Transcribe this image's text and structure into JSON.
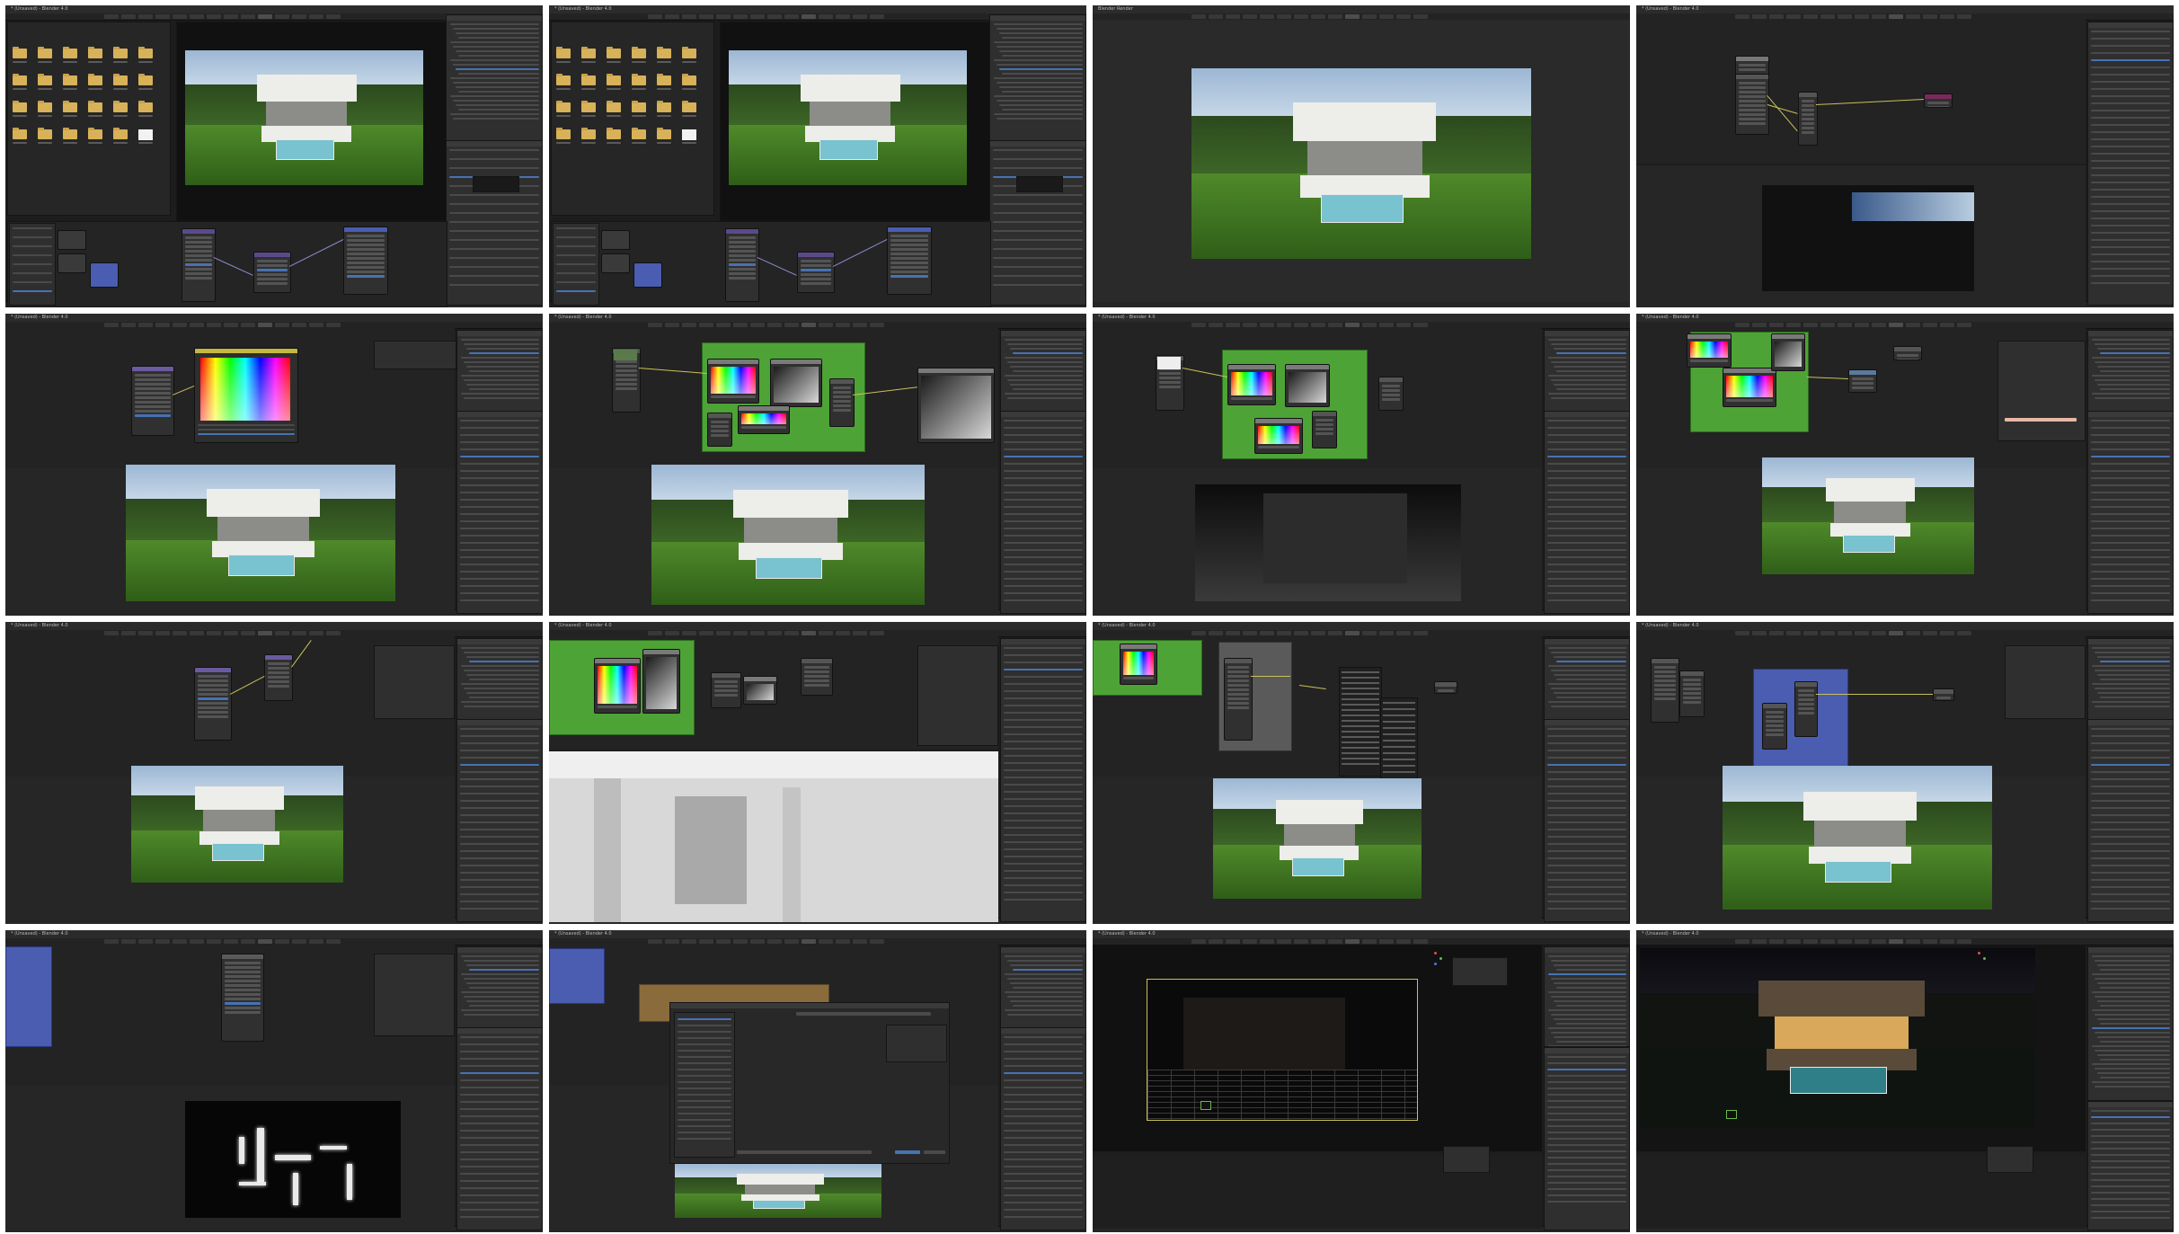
{
  "layout": "4x4 grid of Blender screenshots",
  "window_titles": [
    "* (Unsaved) - Blender 4.0",
    "* (Unsaved) - Blender 4.0",
    "Blender Render",
    "* (Unsaved) - Blender 4.0",
    "* (Unsaved) - Blender 4.0",
    "* (Unsaved) - Blender 4.0",
    "* (Unsaved) - Blender 4.0",
    "* (Unsaved) - Blender 4.0",
    "* (Unsaved) - Blender 4.0",
    "* (Unsaved) - Blender 4.0",
    "* (Unsaved) - Blender 4.0",
    "* (Unsaved) - Blender 4.0",
    "* (Unsaved) - Blender 4.0",
    "* (Unsaved) - Blender 4.0",
    "* (Unsaved) - Blender 4.0",
    "* (Unsaved) - Blender 4.0"
  ],
  "tiles": [
    {
      "kind": "viewport-asset-browser"
    },
    {
      "kind": "viewport-asset-browser-2"
    },
    {
      "kind": "render-window"
    },
    {
      "kind": "compositor-backdrop-dark"
    },
    {
      "kind": "compositor-color-picker"
    },
    {
      "kind": "compositor-green-frame"
    },
    {
      "kind": "compositor-green-frame-depth"
    },
    {
      "kind": "compositor-green-frame-warm"
    },
    {
      "kind": "compositor-purple-nodes"
    },
    {
      "kind": "compositor-clay-render"
    },
    {
      "kind": "compositor-add-menu"
    },
    {
      "kind": "compositor-blue-frame"
    },
    {
      "kind": "compositor-light-groups"
    },
    {
      "kind": "file-browser-dialog"
    },
    {
      "kind": "viewport-night-grid"
    },
    {
      "kind": "viewport-night-house"
    }
  ],
  "colors": {
    "app_bg": "#1d1d1d",
    "panel": "#2f2f2f",
    "accent": "#4772b3",
    "frame_green": "#4ea336",
    "frame_blue": "#4a5db0",
    "wire": "#c9c25a"
  },
  "icons": [
    "folder-icon",
    "camera-icon",
    "light-icon",
    "axis-gizmo-icon",
    "color-wheel-icon"
  ]
}
